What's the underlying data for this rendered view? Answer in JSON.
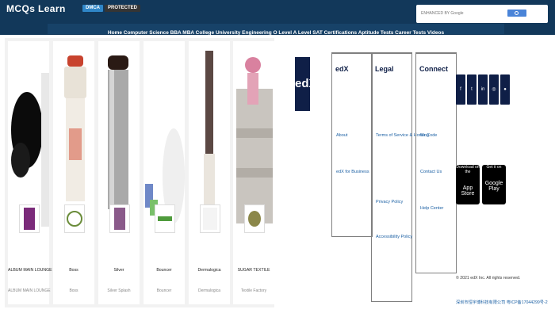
{
  "header": {
    "brand": "MCQs Learn",
    "badges": [
      "DMCA",
      "PROTECTED"
    ],
    "search": {
      "placeholder": "ENHANCED BY Google"
    },
    "nav": "Home Computer Science BBA MBA College University Engineering O Level A Level SAT Certifications Aptitude Tests Career Tests Videos"
  },
  "products": [
    {
      "name": "ALBUM MAIN LOUNGE",
      "category": "ALBUM MAIN LOUNGE"
    },
    {
      "name": "Boss",
      "category": "Boss"
    },
    {
      "name": "Silver",
      "category": "Silver Splash"
    },
    {
      "name": "Bouncer",
      "category": "Bouncer"
    },
    {
      "name": "Dermalogica",
      "category": "Dermalogica"
    },
    {
      "name": "SUGAR TEXTILE",
      "category": "Textile Factory"
    }
  ],
  "footer": {
    "logo_text": "edX",
    "columns": [
      {
        "title": "edX",
        "links": [
          "About",
          "edX for Business"
        ]
      },
      {
        "title": "Legal",
        "links": [
          "Terms of Service & Honor Code",
          "Privacy Policy",
          "Accessibility Policy"
        ]
      },
      {
        "title": "Connect",
        "links": [
          "Blog",
          "Contact Us",
          "Help Center"
        ]
      }
    ],
    "social_icons": [
      "facebook-icon",
      "twitter-icon",
      "linkedin-icon",
      "instagram-icon",
      "reddit-icon"
    ],
    "stores": [
      {
        "small": "Download on the",
        "big": "App Store"
      },
      {
        "small": "Get it on",
        "big": "Google Play"
      }
    ],
    "copyright": "© 2021 edX Inc. All rights reserved.",
    "icp": "深圳市恒宇博科技有限公司 粤ICP备17044299号-2"
  }
}
